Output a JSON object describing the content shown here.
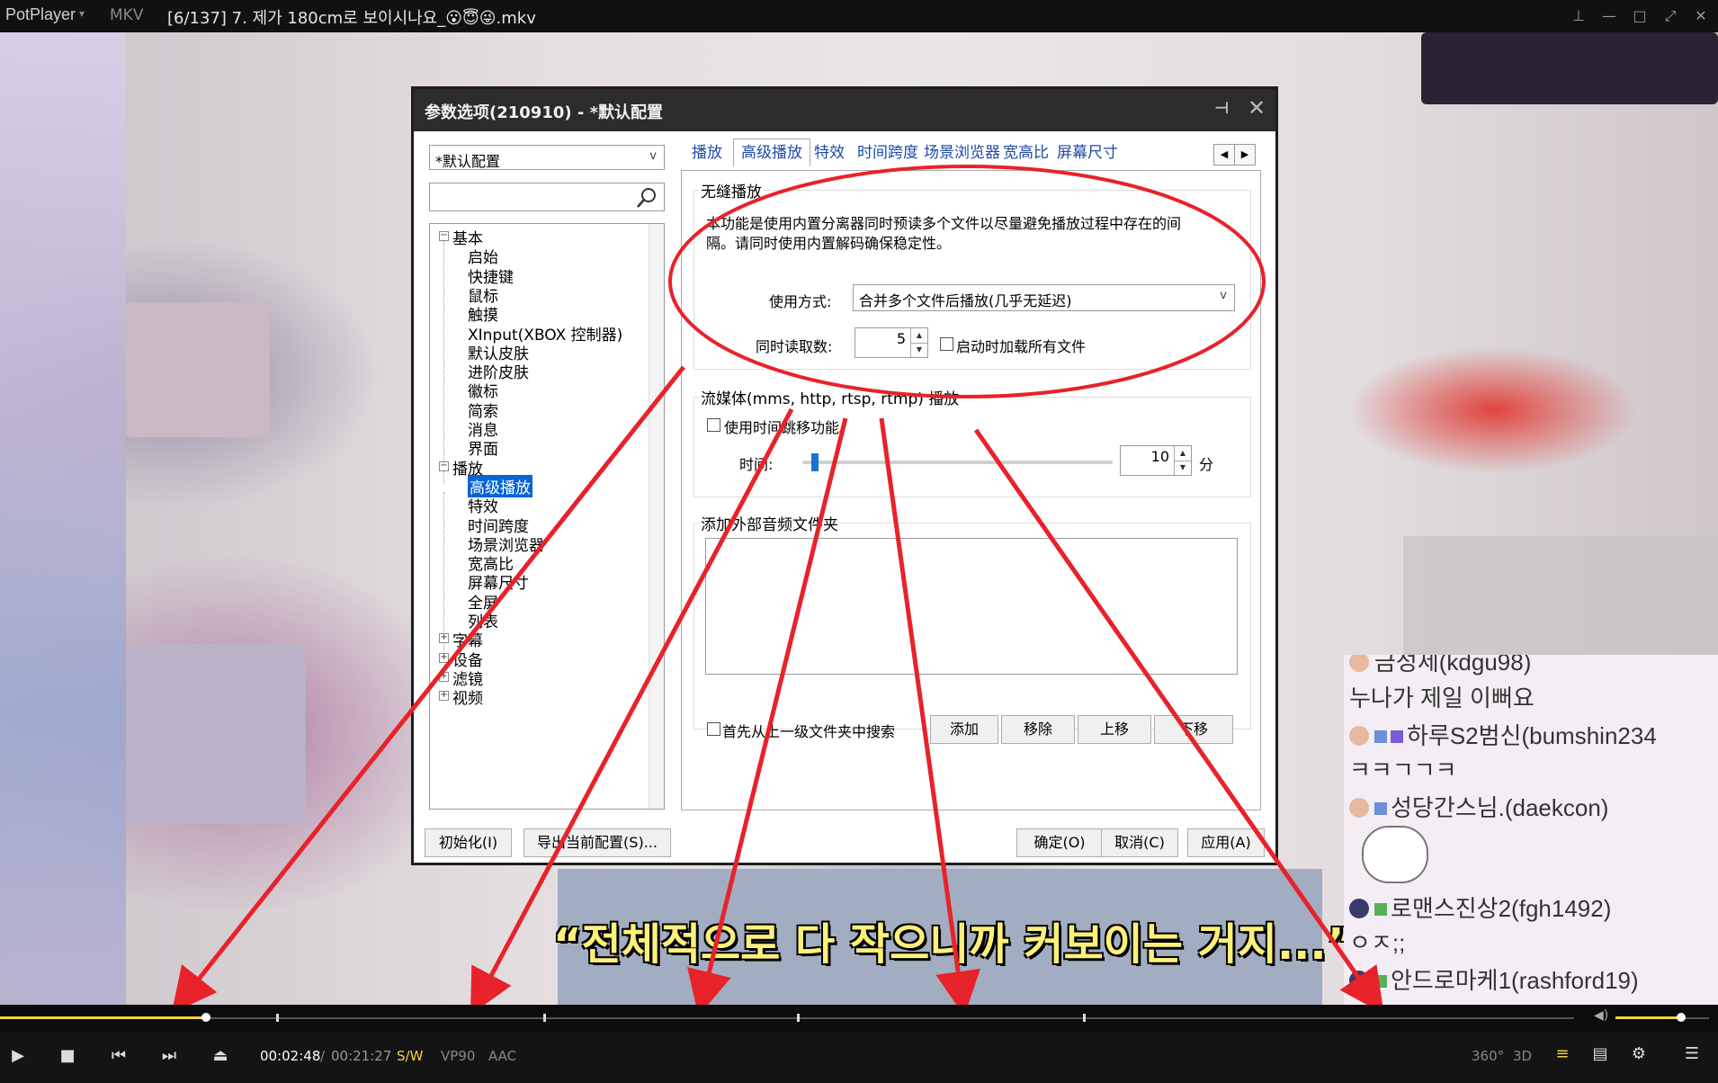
{
  "titlebar": {
    "app": "PotPlayer",
    "format": "MKV",
    "file_title": "[6/137] 7. 제가 180cm로 보이시나요_😮😇😜.mkv"
  },
  "video": {
    "subtitle": "“전체적으로 다 작으니까 커보이는 거지...”"
  },
  "chat": [
    {
      "user": "금성제(kdgu98)",
      "message": "누나가 제일 이뻐요"
    },
    {
      "user": "하루S2범신(bumshin234",
      "message": "ㅋㅋㄱㄱㅋ"
    },
    {
      "user": "성당간스님.(daekcon)",
      "message": ""
    },
    {
      "user": "로맨스진상2(fgh1492)",
      "message": "ㅇㅈ;;"
    },
    {
      "user": "안드로마케1(rashford19)",
      "message": ""
    }
  ],
  "dialog": {
    "title": "参数选项(210910) - *默认配置",
    "profile_select": "*默认配置",
    "tree": [
      {
        "label": "基本",
        "level": 0,
        "expanded": true
      },
      {
        "label": "启始",
        "level": 1
      },
      {
        "label": "快捷键",
        "level": 1
      },
      {
        "label": "鼠标",
        "level": 1
      },
      {
        "label": "触摸",
        "level": 1
      },
      {
        "label": "XInput(XBOX 控制器)",
        "level": 1
      },
      {
        "label": "默认皮肤",
        "level": 1
      },
      {
        "label": "进阶皮肤",
        "level": 1
      },
      {
        "label": "徽标",
        "level": 1
      },
      {
        "label": "简索",
        "level": 1
      },
      {
        "label": "消息",
        "level": 1
      },
      {
        "label": "界面",
        "level": 1
      },
      {
        "label": "播放",
        "level": 0,
        "expanded": true
      },
      {
        "label": "高级播放",
        "level": 1,
        "selected": true
      },
      {
        "label": "特效",
        "level": 1
      },
      {
        "label": "时间跨度",
        "level": 1
      },
      {
        "label": "场景浏览器",
        "level": 1
      },
      {
        "label": "宽高比",
        "level": 1
      },
      {
        "label": "屏幕尺寸",
        "level": 1
      },
      {
        "label": "全屏",
        "level": 1
      },
      {
        "label": "列表",
        "level": 1
      },
      {
        "label": "字幕",
        "level": 0,
        "expanded": false
      },
      {
        "label": "设备",
        "level": 0,
        "expanded": false
      },
      {
        "label": "滤镜",
        "level": 0,
        "expanded": false
      },
      {
        "label": "视频",
        "level": 0,
        "expanded": false
      }
    ],
    "tabs": [
      "播放",
      "高级播放",
      "特效",
      "时间跨度",
      "场景浏览器",
      "宽高比",
      "屏幕尺寸"
    ],
    "active_tab": "高级播放",
    "seamless": {
      "title": "无缝播放",
      "desc_line1": "本功能是使用内置分离器同时预读多个文件以尽量避免播放过程中存在的间",
      "desc_line2": "隔。请同时使用内置解码确保稳定性。",
      "mode_label": "使用方式:",
      "mode_value": "合并多个文件后播放(几乎无延迟)",
      "count_label": "同时读取数:",
      "count_value": "5",
      "load_all_label": "启动时加载所有文件"
    },
    "streaming": {
      "title": "流媒体(mms, http, rtsp, rtmp) 播放",
      "timeshift_label": "使用时间跳移功能。",
      "time_label": "时间:",
      "time_value": "10",
      "time_unit": "分",
      "time_fraction": 0.03
    },
    "audio_folder": {
      "title": "添加外部音频文件夹",
      "search_parent_label": "首先从上一级文件夹中搜索",
      "add": "添加",
      "remove": "移除",
      "up": "上移",
      "down": "下移"
    },
    "buttons": {
      "reset": "初始化(I)",
      "export": "导出当前配置(S)...",
      "ok": "确定(O)",
      "cancel": "取消(C)",
      "apply": "应用(A)"
    }
  },
  "player": {
    "current_time": "00:02:48",
    "separator": "/",
    "total_time": "00:21:27",
    "decoder": "S/W",
    "video_codec": "VP90",
    "audio_codec": "AAC",
    "badge_360": "360°",
    "badge_3d": "3D",
    "progress": 0.131,
    "volume": 0.7,
    "colors": {
      "accent": "#f2d33c",
      "selection": "#0a64d6",
      "annotation": "#e8222a"
    }
  }
}
